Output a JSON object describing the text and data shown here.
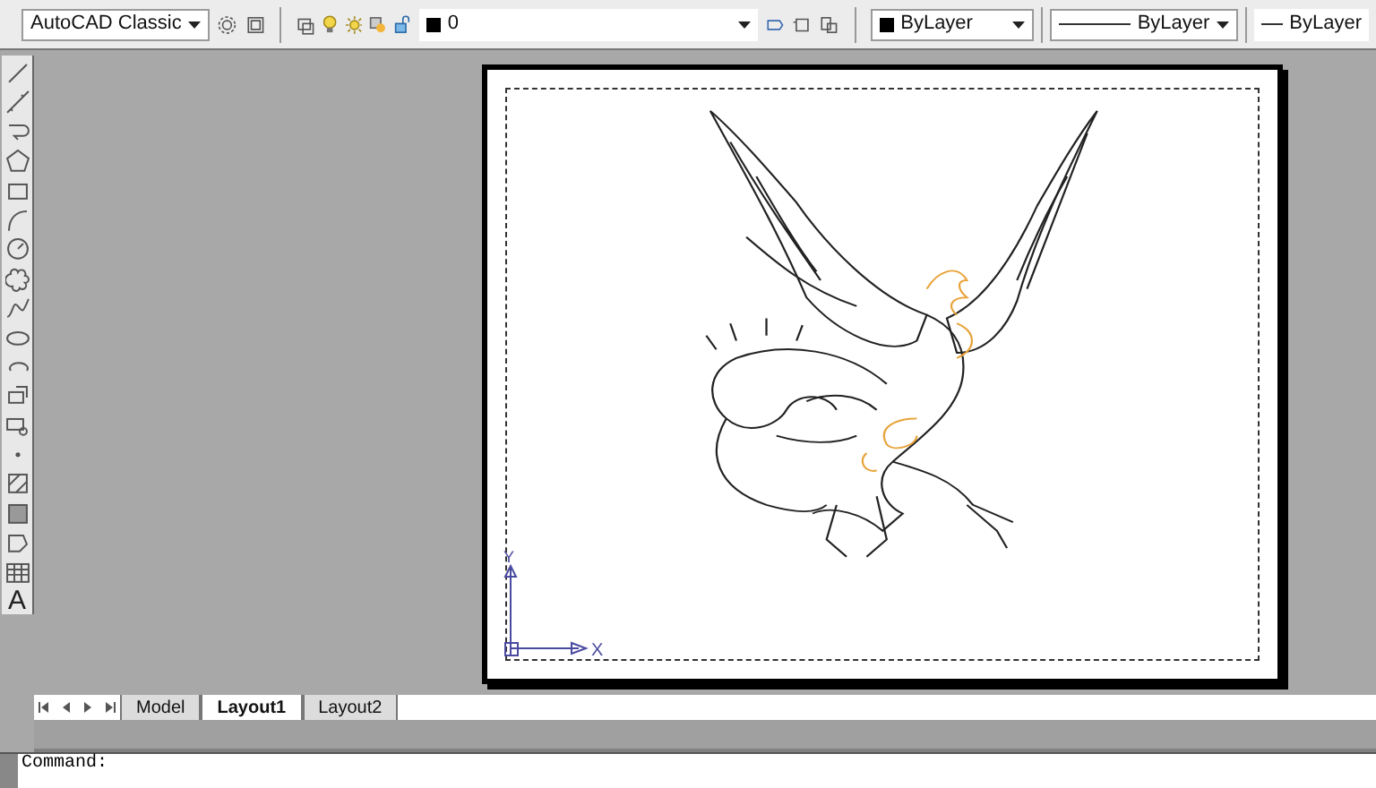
{
  "toolbar": {
    "workspace": "AutoCAD Classic",
    "layer": "0",
    "color_setting": "ByLayer",
    "linetype": "ByLayer",
    "lineweight": "ByLayer"
  },
  "text_tool": "A",
  "ucs": {
    "x_label": "X",
    "y_label": "Y"
  },
  "layout_tabs": [
    {
      "label": "Model",
      "selected": false
    },
    {
      "label": "Layout1",
      "selected": true
    },
    {
      "label": "Layout2",
      "selected": false
    }
  ],
  "command_line": "Command:"
}
